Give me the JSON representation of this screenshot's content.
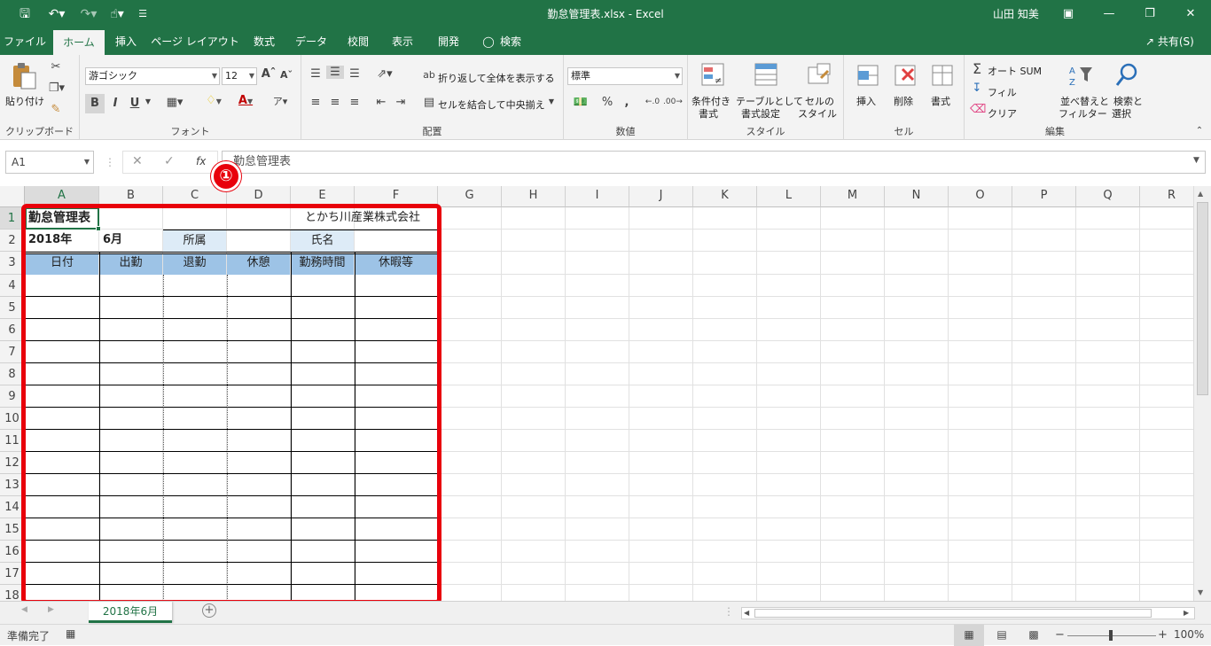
{
  "window": {
    "title": "勤怠管理表.xlsx  -  Excel",
    "user": "山田 知美"
  },
  "tabs": [
    "ファイル",
    "ホーム",
    "挿入",
    "ページ レイアウト",
    "数式",
    "データ",
    "校閲",
    "表示",
    "開発",
    "検索"
  ],
  "share_label": "共有(S)",
  "ribbon": {
    "clipboard": {
      "label": "クリップボード",
      "paste": "貼り付け"
    },
    "font": {
      "label": "フォント",
      "name": "游ゴシック",
      "size": "12",
      "bold": "B",
      "italic": "I",
      "underline": "U"
    },
    "alignment": {
      "label": "配置",
      "wrap": "折り返して全体を表示する",
      "merge": "セルを結合して中央揃え"
    },
    "number": {
      "label": "数値",
      "format": "標準",
      "percent": "%"
    },
    "styles": {
      "label": "スタイル",
      "conditional_l1": "条件付き",
      "conditional_l2": "書式",
      "table_l1": "テーブルとして",
      "table_l2": "書式設定",
      "cell_l1": "セルの",
      "cell_l2": "スタイル"
    },
    "cells": {
      "label": "セル",
      "insert": "挿入",
      "delete": "削除",
      "format": "書式"
    },
    "editing": {
      "label": "編集",
      "autosum": "オート SUM",
      "fill": "フィル",
      "clear": "クリア",
      "sort_l1": "並べ替えと",
      "sort_l2": "フィルター",
      "find_l1": "検索と",
      "find_l2": "選択"
    }
  },
  "formula_bar": {
    "name_box": "A1",
    "fx": "fx",
    "value": "勤怠管理表"
  },
  "columns": [
    "A",
    "B",
    "C",
    "D",
    "E",
    "F",
    "G",
    "H",
    "I",
    "J",
    "K",
    "L",
    "M",
    "N",
    "O",
    "P",
    "Q",
    "R"
  ],
  "rows": [
    "1",
    "2",
    "3",
    "4",
    "5",
    "6",
    "7",
    "8",
    "9",
    "10",
    "11",
    "12",
    "13",
    "14",
    "15",
    "16",
    "17",
    "18"
  ],
  "sheet": {
    "title": "勤怠管理表",
    "company": "とかち川産業株式会社",
    "year": "2018年",
    "month": "6月",
    "dept_label": "所属",
    "name_label": "氏名",
    "headers": [
      "日付",
      "出勤",
      "退勤",
      "休憩",
      "勤務時間",
      "休暇等"
    ]
  },
  "annotation": "①",
  "sheet_tabs": [
    "2018年6月"
  ],
  "status": {
    "ready": "準備完了",
    "zoom": "100%"
  },
  "colors": {
    "accent": "#217346",
    "header_fill": "#9dc3e6",
    "label_fill": "#ddebf7",
    "highlight": "#e8000b"
  }
}
